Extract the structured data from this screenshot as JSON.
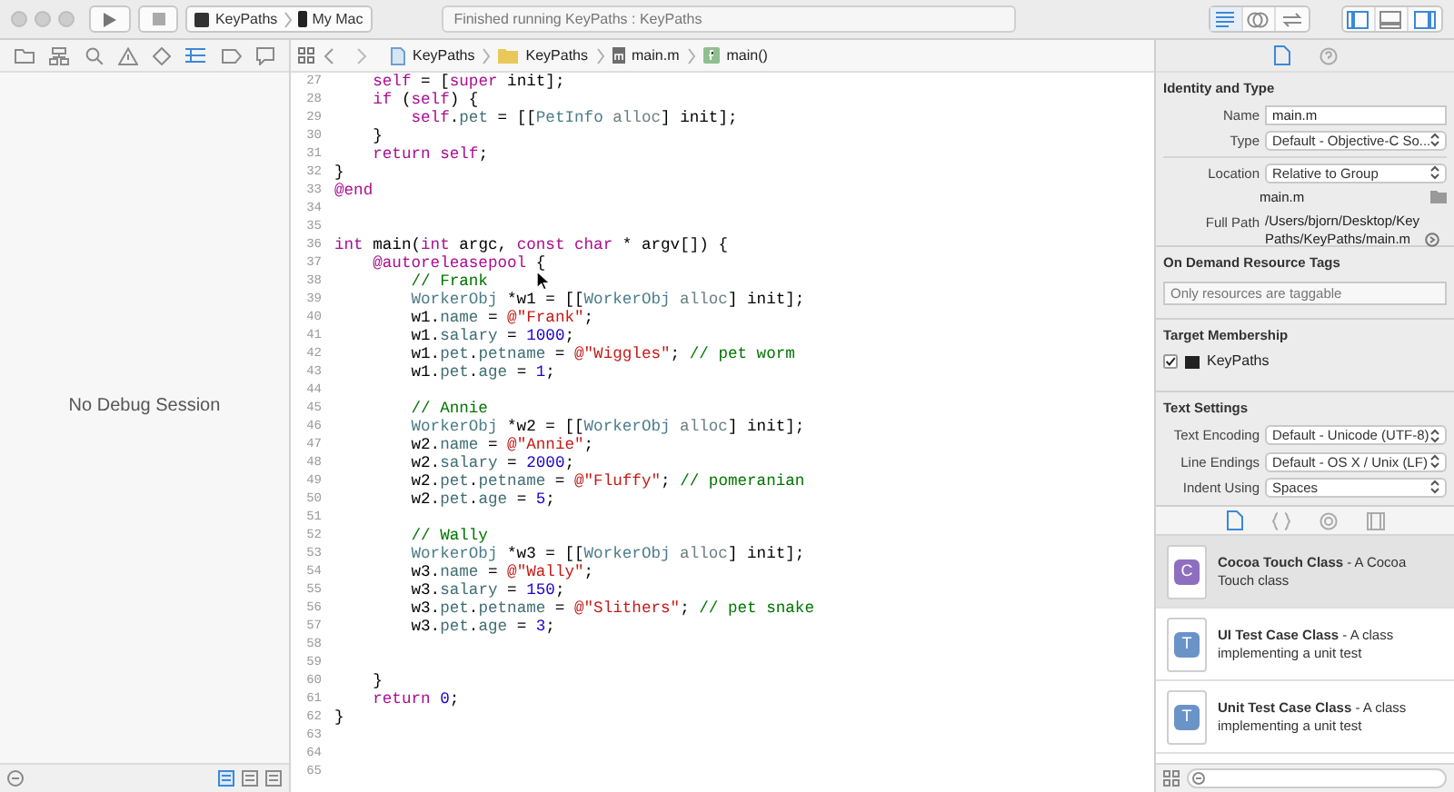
{
  "toolbar": {
    "scheme": "KeyPaths",
    "destination": "My Mac",
    "status": "Finished running KeyPaths : KeyPaths",
    "editor_modes": [
      {
        "kind": "standard",
        "selected": true
      },
      {
        "kind": "assistant",
        "selected": false
      },
      {
        "kind": "version",
        "selected": false
      }
    ],
    "panels": [
      {
        "kind": "navigator",
        "on": true
      },
      {
        "kind": "debug",
        "on": false
      },
      {
        "kind": "utilities",
        "on": true
      }
    ]
  },
  "navigator": {
    "tabs": [
      {
        "kind": "project",
        "selected": false
      },
      {
        "kind": "symbol",
        "selected": false
      },
      {
        "kind": "find",
        "selected": false
      },
      {
        "kind": "issue",
        "selected": false
      },
      {
        "kind": "test",
        "selected": false
      },
      {
        "kind": "debug",
        "selected": true
      },
      {
        "kind": "breakpoint",
        "selected": false
      },
      {
        "kind": "report",
        "selected": false
      }
    ],
    "message": "No Debug Session",
    "view_modes": [
      {
        "selected": true
      },
      {
        "selected": false
      },
      {
        "selected": false
      }
    ]
  },
  "jump_bar": [
    {
      "kind": "project",
      "label": "KeyPaths"
    },
    {
      "kind": "folder",
      "label": "KeyPaths"
    },
    {
      "kind": "file",
      "label": "main.m"
    },
    {
      "kind": "function",
      "label": "main()"
    }
  ],
  "code": [
    {
      "number": "27",
      "tokens": [
        {
          "kind": "keyword",
          "text": "    self"
        },
        {
          "kind": "plain",
          "text": " = ["
        },
        {
          "kind": "keyword",
          "text": "super"
        },
        {
          "kind": "plain",
          "text": " init];"
        }
      ]
    },
    {
      "number": "28",
      "tokens": [
        {
          "kind": "keyword",
          "text": "    if"
        },
        {
          "kind": "plain",
          "text": " ("
        },
        {
          "kind": "keyword",
          "text": "self"
        },
        {
          "kind": "plain",
          "text": ") {"
        }
      ]
    },
    {
      "number": "29",
      "tokens": [
        {
          "kind": "keyword",
          "text": "        self"
        },
        {
          "kind": "plain",
          "text": "."
        },
        {
          "kind": "property",
          "text": "pet"
        },
        {
          "kind": "plain",
          "text": " = [["
        },
        {
          "kind": "class",
          "text": "PetInfo"
        },
        {
          "kind": "method",
          "text": " alloc"
        },
        {
          "kind": "plain",
          "text": "] init];"
        }
      ]
    },
    {
      "number": "30",
      "tokens": [
        {
          "kind": "plain",
          "text": "    }"
        }
      ]
    },
    {
      "number": "31",
      "tokens": [
        {
          "kind": "keyword",
          "text": "    return self"
        },
        {
          "kind": "plain",
          "text": ";"
        }
      ]
    },
    {
      "number": "32",
      "tokens": [
        {
          "kind": "plain",
          "text": "}"
        }
      ]
    },
    {
      "number": "33",
      "tokens": [
        {
          "kind": "keyword",
          "text": "@end"
        }
      ]
    },
    {
      "number": "34"
    },
    {
      "number": "35"
    },
    {
      "number": "36",
      "tokens": [
        {
          "kind": "keyword",
          "text": "int"
        },
        {
          "kind": "plain",
          "text": " main("
        },
        {
          "kind": "keyword",
          "text": "int"
        },
        {
          "kind": "plain",
          "text": " argc, "
        },
        {
          "kind": "keyword",
          "text": "const char"
        },
        {
          "kind": "plain",
          "text": " * argv[]) {"
        }
      ]
    },
    {
      "number": "37",
      "tokens": [
        {
          "kind": "keyword",
          "text": "    @autoreleasepool"
        },
        {
          "kind": "plain",
          "text": " {"
        }
      ]
    },
    {
      "number": "38",
      "tokens": [
        {
          "kind": "comment",
          "text": "        // Frank"
        }
      ]
    },
    {
      "number": "39",
      "tokens": [
        {
          "kind": "class",
          "text": "        WorkerObj"
        },
        {
          "kind": "plain",
          "text": " *w1 = [["
        },
        {
          "kind": "class",
          "text": "WorkerObj"
        },
        {
          "kind": "method",
          "text": " alloc"
        },
        {
          "kind": "plain",
          "text": "] init];"
        }
      ]
    },
    {
      "number": "40",
      "tokens": [
        {
          "kind": "plain",
          "text": "        w1."
        },
        {
          "kind": "property",
          "text": "name"
        },
        {
          "kind": "plain",
          "text": " = "
        },
        {
          "kind": "string",
          "text": "@\"Frank\""
        },
        {
          "kind": "plain",
          "text": ";"
        }
      ]
    },
    {
      "number": "41",
      "tokens": [
        {
          "kind": "plain",
          "text": "        w1."
        },
        {
          "kind": "property",
          "text": "salary"
        },
        {
          "kind": "plain",
          "text": " = "
        },
        {
          "kind": "number",
          "text": "1000"
        },
        {
          "kind": "plain",
          "text": ";"
        }
      ]
    },
    {
      "number": "42",
      "tokens": [
        {
          "kind": "plain",
          "text": "        w1."
        },
        {
          "kind": "property",
          "text": "pet"
        },
        {
          "kind": "plain",
          "text": "."
        },
        {
          "kind": "property",
          "text": "petname"
        },
        {
          "kind": "plain",
          "text": " = "
        },
        {
          "kind": "string",
          "text": "@\"Wiggles\""
        },
        {
          "kind": "plain",
          "text": "; "
        },
        {
          "kind": "comment",
          "text": "// pet worm"
        }
      ]
    },
    {
      "number": "43",
      "tokens": [
        {
          "kind": "plain",
          "text": "        w1."
        },
        {
          "kind": "property",
          "text": "pet"
        },
        {
          "kind": "plain",
          "text": "."
        },
        {
          "kind": "property",
          "text": "age"
        },
        {
          "kind": "plain",
          "text": " = "
        },
        {
          "kind": "number",
          "text": "1"
        },
        {
          "kind": "plain",
          "text": ";"
        }
      ]
    },
    {
      "number": "44"
    },
    {
      "number": "45",
      "tokens": [
        {
          "kind": "comment",
          "text": "        // Annie"
        }
      ]
    },
    {
      "number": "46",
      "tokens": [
        {
          "kind": "class",
          "text": "        WorkerObj"
        },
        {
          "kind": "plain",
          "text": " *w2 = [["
        },
        {
          "kind": "class",
          "text": "WorkerObj"
        },
        {
          "kind": "method",
          "text": " alloc"
        },
        {
          "kind": "plain",
          "text": "] init];"
        }
      ]
    },
    {
      "number": "47",
      "tokens": [
        {
          "kind": "plain",
          "text": "        w2."
        },
        {
          "kind": "property",
          "text": "name"
        },
        {
          "kind": "plain",
          "text": " = "
        },
        {
          "kind": "string",
          "text": "@\"Annie\""
        },
        {
          "kind": "plain",
          "text": ";"
        }
      ]
    },
    {
      "number": "48",
      "tokens": [
        {
          "kind": "plain",
          "text": "        w2."
        },
        {
          "kind": "property",
          "text": "salary"
        },
        {
          "kind": "plain",
          "text": " = "
        },
        {
          "kind": "number",
          "text": "2000"
        },
        {
          "kind": "plain",
          "text": ";"
        }
      ]
    },
    {
      "number": "49",
      "tokens": [
        {
          "kind": "plain",
          "text": "        w2."
        },
        {
          "kind": "property",
          "text": "pet"
        },
        {
          "kind": "plain",
          "text": "."
        },
        {
          "kind": "property",
          "text": "petname"
        },
        {
          "kind": "plain",
          "text": " = "
        },
        {
          "kind": "string",
          "text": "@\"Fluffy\""
        },
        {
          "kind": "plain",
          "text": "; "
        },
        {
          "kind": "comment",
          "text": "// pomeranian"
        }
      ]
    },
    {
      "number": "50",
      "tokens": [
        {
          "kind": "plain",
          "text": "        w2."
        },
        {
          "kind": "property",
          "text": "pet"
        },
        {
          "kind": "plain",
          "text": "."
        },
        {
          "kind": "property",
          "text": "age"
        },
        {
          "kind": "plain",
          "text": " = "
        },
        {
          "kind": "number",
          "text": "5"
        },
        {
          "kind": "plain",
          "text": ";"
        }
      ]
    },
    {
      "number": "51"
    },
    {
      "number": "52",
      "tokens": [
        {
          "kind": "comment",
          "text": "        // Wally"
        }
      ]
    },
    {
      "number": "53",
      "tokens": [
        {
          "kind": "class",
          "text": "        WorkerObj"
        },
        {
          "kind": "plain",
          "text": " *w3 = [["
        },
        {
          "kind": "class",
          "text": "WorkerObj"
        },
        {
          "kind": "method",
          "text": " alloc"
        },
        {
          "kind": "plain",
          "text": "] init];"
        }
      ]
    },
    {
      "number": "54",
      "tokens": [
        {
          "kind": "plain",
          "text": "        w3."
        },
        {
          "kind": "property",
          "text": "name"
        },
        {
          "kind": "plain",
          "text": " = "
        },
        {
          "kind": "string",
          "text": "@\"Wally\""
        },
        {
          "kind": "plain",
          "text": ";"
        }
      ]
    },
    {
      "number": "55",
      "tokens": [
        {
          "kind": "plain",
          "text": "        w3."
        },
        {
          "kind": "property",
          "text": "salary"
        },
        {
          "kind": "plain",
          "text": " = "
        },
        {
          "kind": "number",
          "text": "150"
        },
        {
          "kind": "plain",
          "text": ";"
        }
      ]
    },
    {
      "number": "56",
      "tokens": [
        {
          "kind": "plain",
          "text": "        w3."
        },
        {
          "kind": "property",
          "text": "pet"
        },
        {
          "kind": "plain",
          "text": "."
        },
        {
          "kind": "property",
          "text": "petname"
        },
        {
          "kind": "plain",
          "text": " = "
        },
        {
          "kind": "string",
          "text": "@\"Slithers\""
        },
        {
          "kind": "plain",
          "text": "; "
        },
        {
          "kind": "comment",
          "text": "// pet snake"
        }
      ]
    },
    {
      "number": "57",
      "tokens": [
        {
          "kind": "plain",
          "text": "        w3."
        },
        {
          "kind": "property",
          "text": "pet"
        },
        {
          "kind": "plain",
          "text": "."
        },
        {
          "kind": "property",
          "text": "age"
        },
        {
          "kind": "plain",
          "text": " = "
        },
        {
          "kind": "number",
          "text": "3"
        },
        {
          "kind": "plain",
          "text": ";"
        }
      ]
    },
    {
      "number": "58"
    },
    {
      "number": "59"
    },
    {
      "number": "60",
      "tokens": [
        {
          "kind": "plain",
          "text": "    }"
        }
      ]
    },
    {
      "number": "61",
      "tokens": [
        {
          "kind": "keyword",
          "text": "    return"
        },
        {
          "kind": "number",
          "text": " 0"
        },
        {
          "kind": "plain",
          "text": ";"
        }
      ]
    },
    {
      "number": "62",
      "tokens": [
        {
          "kind": "plain",
          "text": "}"
        }
      ]
    },
    {
      "number": "63"
    },
    {
      "number": "64"
    },
    {
      "number": "65"
    }
  ],
  "inspector": {
    "tabs": [
      {
        "kind": "file",
        "selected": true
      },
      {
        "kind": "help",
        "selected": false
      }
    ],
    "identity": {
      "title": "Identity and Type",
      "name_label": "Name",
      "name": "main.m",
      "type_label": "Type",
      "type": "Default - Objective-C So...",
      "location_label": "Location",
      "location": "Relative to Group",
      "file_name": "main.m",
      "full_path_label": "Full Path",
      "full_path": "/Users/bjorn/Desktop/KeyPaths/KeyPaths/main.m"
    },
    "resource_tags": {
      "title": "On Demand Resource Tags",
      "placeholder": "Only resources are taggable"
    },
    "target_membership": {
      "title": "Target Membership",
      "targets": [
        {
          "name": "KeyPaths",
          "checked": true
        }
      ]
    },
    "text_settings": {
      "title": "Text Settings",
      "rows": [
        {
          "label": "Text Encoding",
          "value": "Default - Unicode (UTF-8)"
        },
        {
          "label": "Line Endings",
          "value": "Default - OS X / Unix (LF)"
        },
        {
          "label": "Indent Using",
          "value": "Spaces"
        }
      ]
    }
  },
  "library": {
    "tabs": [
      {
        "kind": "file",
        "selected": true
      },
      {
        "kind": "code",
        "selected": false
      },
      {
        "kind": "object",
        "selected": false
      },
      {
        "kind": "media",
        "selected": false
      }
    ],
    "templates": [
      {
        "badge": "C",
        "color": "#8e6fbf",
        "title": "Cocoa Touch Class",
        "description": " - A Cocoa Touch class",
        "selected": true
      },
      {
        "badge": "T",
        "color": "#6a93c8",
        "title": "UI Test Case Class",
        "description": " - A class implementing a unit test",
        "selected": false
      },
      {
        "badge": "T",
        "color": "#6a93c8",
        "title": "Unit Test Case Class",
        "description": " - A class implementing a unit test",
        "selected": false
      }
    ]
  }
}
